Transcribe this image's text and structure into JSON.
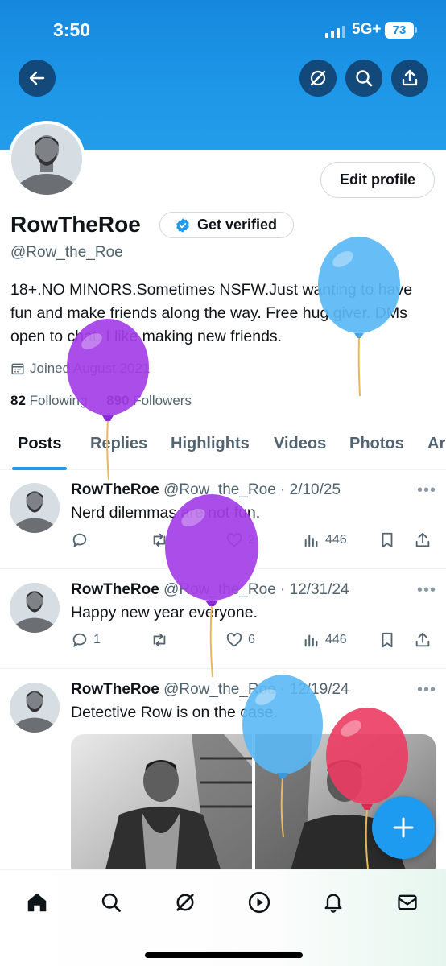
{
  "status_bar": {
    "time": "3:50",
    "network": "5G+",
    "battery": "73"
  },
  "profile": {
    "name": "RowTheRoe",
    "verify_label": "Get verified",
    "handle": "@Row_the_Roe",
    "bio": "18+.NO MINORS.Sometimes NSFW.Just wanting to have fun and make friends along the way. Free hug giver. DMs open to chat. I like making new friends.",
    "joined": "Joined August 2021",
    "following_count": "82",
    "following_label": "Following",
    "followers_count": "890",
    "followers_label": "Followers",
    "edit_label": "Edit profile"
  },
  "tabs": [
    {
      "label": "Posts",
      "active": true
    },
    {
      "label": "Replies"
    },
    {
      "label": "Highlights"
    },
    {
      "label": "Videos"
    },
    {
      "label": "Photos"
    },
    {
      "label": "Ar"
    }
  ],
  "tweets": [
    {
      "name": "RowTheRoe",
      "meta": "@Row_the_Roe · 2/10/25",
      "text": "Nerd dilemmas are not fun.",
      "replies": "",
      "retweets": "",
      "likes": "2",
      "views": "446"
    },
    {
      "name": "RowTheRoe",
      "meta": "@Row_the_Roe · 12/31/24",
      "text": "Happy new year everyone.",
      "replies": "1",
      "retweets": "",
      "likes": "6",
      "views": "446"
    },
    {
      "name": "RowTheRoe",
      "meta": "@Row_the_Roe · 12/19/24",
      "text": "Detective Row is on the case."
    }
  ],
  "colors": {
    "accent": "#1d9bf0",
    "banner": "#1e97e8",
    "balloon_purple": "#a43ee6",
    "balloon_blue": "#5ab8f5",
    "balloon_red": "#ec3b63"
  },
  "icons": {
    "back": "arrow-left-icon",
    "grok": "grok-icon",
    "search": "search-icon",
    "share": "share-icon"
  }
}
